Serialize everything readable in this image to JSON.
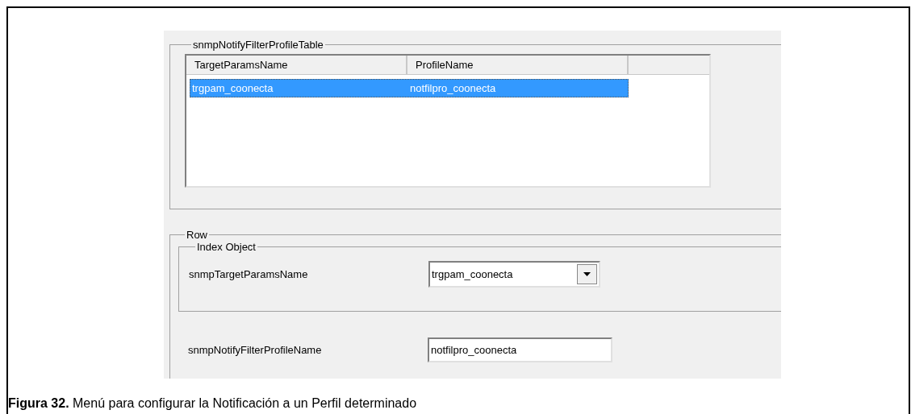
{
  "table_group": {
    "title": "snmpNotifyFilterProfileTable",
    "columns": [
      "TargetParamsName",
      "ProfileName"
    ],
    "rows": [
      {
        "cells": [
          "trgpam_coonecta",
          "notfilpro_coonecta"
        ],
        "selected": true
      }
    ]
  },
  "row_group": {
    "title": "Row",
    "index_group": {
      "title": "Index Object",
      "fields": [
        {
          "label": "snmpTargetParamsName",
          "value": "trgpam_coonecta",
          "kind": "dropdown"
        }
      ]
    },
    "fields": [
      {
        "label": "snmpNotifyFilterProfileName",
        "value": "notfilpro_coonecta",
        "kind": "text"
      }
    ]
  },
  "caption": "**Figura 32.** Menú para configurar la Notificación a un Perfil determinado"
}
